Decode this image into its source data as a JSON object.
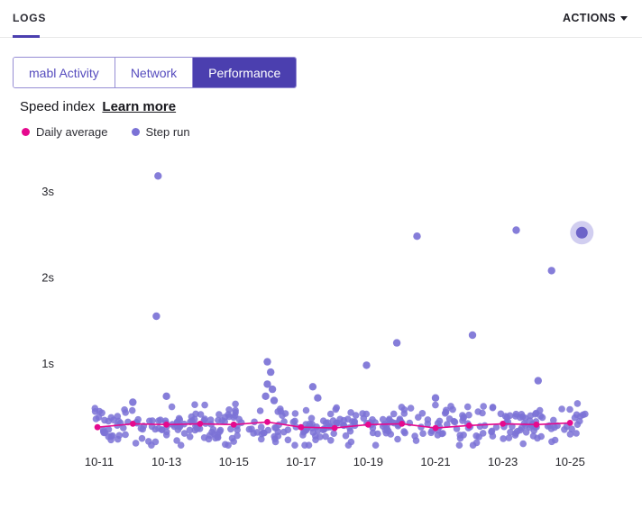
{
  "header": {
    "logs_label": "LOGS",
    "actions_label": "ACTIONS"
  },
  "tabs": [
    {
      "label": "mabl Activity",
      "active": false
    },
    {
      "label": "Network",
      "active": false
    },
    {
      "label": "Performance",
      "active": true
    }
  ],
  "chart_header": {
    "title": "Speed index",
    "learn_more": "Learn more"
  },
  "legend": [
    {
      "label": "Daily average",
      "color": "#e5098e"
    },
    {
      "label": "Step run",
      "color": "#7b72d6"
    }
  ],
  "colors": {
    "accent_indigo": "#4b3faf",
    "tab_border": "#968dd4",
    "daily_average_pink": "#e5098e",
    "step_run_purple": "#7b72d6",
    "highlight_halo": "#9a92de"
  },
  "chart_data": {
    "type": "scatter",
    "title": "Speed index",
    "x_axis": {
      "tick_days": [
        11,
        13,
        15,
        17,
        19,
        21,
        23,
        25
      ],
      "tick_labels": [
        "10-11",
        "10-13",
        "10-15",
        "10-17",
        "10-19",
        "10-21",
        "10-23",
        "10-25"
      ]
    },
    "y_axis": {
      "tick_values": [
        3,
        2,
        1
      ],
      "tick_labels": [
        "3s",
        "2s",
        "1s"
      ],
      "unit": "seconds",
      "ylim": [
        0,
        3.5
      ]
    },
    "grid": false,
    "legend_position": "top-left",
    "series": [
      {
        "name": "Daily average",
        "type": "line",
        "color": "#e5098e",
        "points": [
          [
            10.95,
            0.26
          ],
          [
            12,
            0.3
          ],
          [
            13,
            0.29
          ],
          [
            14,
            0.3
          ],
          [
            15,
            0.29
          ],
          [
            16,
            0.32
          ],
          [
            17,
            0.26
          ],
          [
            18,
            0.25
          ],
          [
            19,
            0.29
          ],
          [
            20,
            0.3
          ],
          [
            21,
            0.25
          ],
          [
            22,
            0.28
          ],
          [
            23,
            0.3
          ],
          [
            24,
            0.29
          ],
          [
            25,
            0.31
          ]
        ]
      },
      {
        "name": "Step run",
        "type": "scatter",
        "color": "#7b72d6",
        "outliers": [
          [
            12.75,
            3.18
          ],
          [
            12.7,
            1.55
          ],
          [
            16.0,
            1.02
          ],
          [
            16.1,
            0.9
          ],
          [
            16.0,
            0.76
          ],
          [
            16.15,
            0.7
          ],
          [
            15.95,
            0.62
          ],
          [
            16.2,
            0.57
          ],
          [
            17.35,
            0.73
          ],
          [
            17.5,
            0.6
          ],
          [
            18.95,
            0.98
          ],
          [
            19.85,
            1.24
          ],
          [
            20.45,
            2.48
          ],
          [
            21.0,
            0.6
          ],
          [
            22.1,
            1.33
          ],
          [
            23.4,
            2.55
          ],
          [
            24.45,
            2.08
          ],
          [
            24.05,
            0.8
          ],
          [
            13.0,
            0.62
          ],
          [
            12.0,
            0.55
          ]
        ],
        "highlight_point": {
          "day": 25.35,
          "value": 2.52
        },
        "cluster": {
          "count": 380,
          "day_min": 10.85,
          "day_max": 25.45,
          "value_mean": 0.27,
          "value_spread": 0.14,
          "value_min": 0.05,
          "value_max": 0.56,
          "seed": 42
        }
      }
    ]
  }
}
